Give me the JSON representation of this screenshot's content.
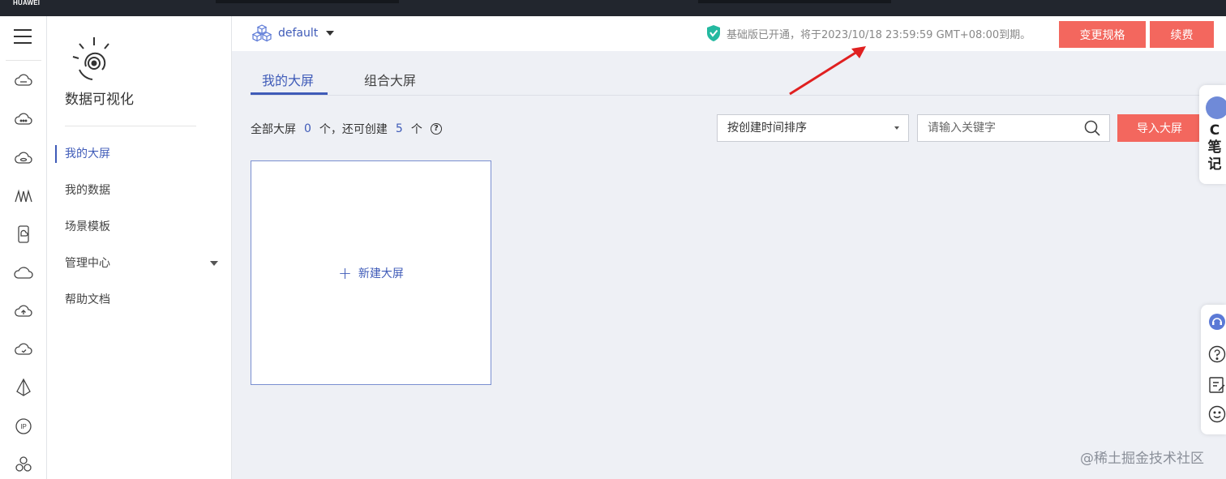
{
  "topbar": {
    "brand": "HUAWEI"
  },
  "rail": {
    "icons": [
      "cloud-server-icon",
      "cloud-dots-icon",
      "cloud-db-icon",
      "waveform-icon",
      "mobile-cloud-icon",
      "cloud-icon",
      "cloud-upload-icon",
      "cloud-refresh-icon",
      "pyramid-icon",
      "ip-icon",
      "cluster-icon"
    ]
  },
  "nav": {
    "title": "数据可视化",
    "items": [
      {
        "label": "我的大屏",
        "active": true
      },
      {
        "label": "我的数据"
      },
      {
        "label": "场景模板"
      },
      {
        "label": "管理中心",
        "has_dropdown": true
      },
      {
        "label": "帮助文档"
      }
    ]
  },
  "header": {
    "project": "default",
    "notice": "基础版已开通，将于2023/10/18 23:59:59 GMT+08:00到期。",
    "change_spec_label": "变更规格",
    "renew_label": "续费"
  },
  "tabs": [
    {
      "label": "我的大屏",
      "active": true
    },
    {
      "label": "组合大屏"
    }
  ],
  "count": {
    "prefix": "全部大屏",
    "total": "0",
    "mid": "个，还可创建",
    "remaining": "5",
    "suffix": "个"
  },
  "sort": {
    "selected": "按创建时间排序"
  },
  "search": {
    "placeholder": "请输入关键字"
  },
  "import_label": "导入大屏",
  "card": {
    "new_label": "新建大屏"
  },
  "floating": {
    "note_text": "C笔记"
  },
  "watermark": "@稀土掘金技术社区",
  "colors": {
    "accent": "#3f5bb8",
    "danger": "#f3675e",
    "annotation": "#e02020"
  }
}
